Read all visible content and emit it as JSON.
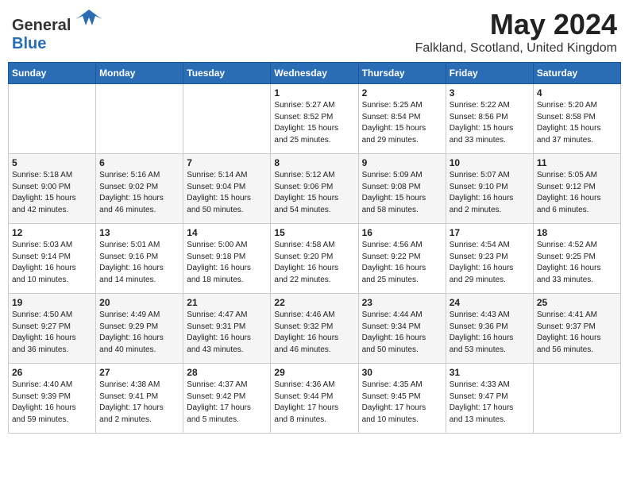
{
  "header": {
    "logo_general": "General",
    "logo_blue": "Blue",
    "month_year": "May 2024",
    "location": "Falkland, Scotland, United Kingdom"
  },
  "days_of_week": [
    "Sunday",
    "Monday",
    "Tuesday",
    "Wednesday",
    "Thursday",
    "Friday",
    "Saturday"
  ],
  "weeks": [
    [
      {
        "day": "",
        "info": ""
      },
      {
        "day": "",
        "info": ""
      },
      {
        "day": "",
        "info": ""
      },
      {
        "day": "1",
        "info": "Sunrise: 5:27 AM\nSunset: 8:52 PM\nDaylight: 15 hours\nand 25 minutes."
      },
      {
        "day": "2",
        "info": "Sunrise: 5:25 AM\nSunset: 8:54 PM\nDaylight: 15 hours\nand 29 minutes."
      },
      {
        "day": "3",
        "info": "Sunrise: 5:22 AM\nSunset: 8:56 PM\nDaylight: 15 hours\nand 33 minutes."
      },
      {
        "day": "4",
        "info": "Sunrise: 5:20 AM\nSunset: 8:58 PM\nDaylight: 15 hours\nand 37 minutes."
      }
    ],
    [
      {
        "day": "5",
        "info": "Sunrise: 5:18 AM\nSunset: 9:00 PM\nDaylight: 15 hours\nand 42 minutes."
      },
      {
        "day": "6",
        "info": "Sunrise: 5:16 AM\nSunset: 9:02 PM\nDaylight: 15 hours\nand 46 minutes."
      },
      {
        "day": "7",
        "info": "Sunrise: 5:14 AM\nSunset: 9:04 PM\nDaylight: 15 hours\nand 50 minutes."
      },
      {
        "day": "8",
        "info": "Sunrise: 5:12 AM\nSunset: 9:06 PM\nDaylight: 15 hours\nand 54 minutes."
      },
      {
        "day": "9",
        "info": "Sunrise: 5:09 AM\nSunset: 9:08 PM\nDaylight: 15 hours\nand 58 minutes."
      },
      {
        "day": "10",
        "info": "Sunrise: 5:07 AM\nSunset: 9:10 PM\nDaylight: 16 hours\nand 2 minutes."
      },
      {
        "day": "11",
        "info": "Sunrise: 5:05 AM\nSunset: 9:12 PM\nDaylight: 16 hours\nand 6 minutes."
      }
    ],
    [
      {
        "day": "12",
        "info": "Sunrise: 5:03 AM\nSunset: 9:14 PM\nDaylight: 16 hours\nand 10 minutes."
      },
      {
        "day": "13",
        "info": "Sunrise: 5:01 AM\nSunset: 9:16 PM\nDaylight: 16 hours\nand 14 minutes."
      },
      {
        "day": "14",
        "info": "Sunrise: 5:00 AM\nSunset: 9:18 PM\nDaylight: 16 hours\nand 18 minutes."
      },
      {
        "day": "15",
        "info": "Sunrise: 4:58 AM\nSunset: 9:20 PM\nDaylight: 16 hours\nand 22 minutes."
      },
      {
        "day": "16",
        "info": "Sunrise: 4:56 AM\nSunset: 9:22 PM\nDaylight: 16 hours\nand 25 minutes."
      },
      {
        "day": "17",
        "info": "Sunrise: 4:54 AM\nSunset: 9:23 PM\nDaylight: 16 hours\nand 29 minutes."
      },
      {
        "day": "18",
        "info": "Sunrise: 4:52 AM\nSunset: 9:25 PM\nDaylight: 16 hours\nand 33 minutes."
      }
    ],
    [
      {
        "day": "19",
        "info": "Sunrise: 4:50 AM\nSunset: 9:27 PM\nDaylight: 16 hours\nand 36 minutes."
      },
      {
        "day": "20",
        "info": "Sunrise: 4:49 AM\nSunset: 9:29 PM\nDaylight: 16 hours\nand 40 minutes."
      },
      {
        "day": "21",
        "info": "Sunrise: 4:47 AM\nSunset: 9:31 PM\nDaylight: 16 hours\nand 43 minutes."
      },
      {
        "day": "22",
        "info": "Sunrise: 4:46 AM\nSunset: 9:32 PM\nDaylight: 16 hours\nand 46 minutes."
      },
      {
        "day": "23",
        "info": "Sunrise: 4:44 AM\nSunset: 9:34 PM\nDaylight: 16 hours\nand 50 minutes."
      },
      {
        "day": "24",
        "info": "Sunrise: 4:43 AM\nSunset: 9:36 PM\nDaylight: 16 hours\nand 53 minutes."
      },
      {
        "day": "25",
        "info": "Sunrise: 4:41 AM\nSunset: 9:37 PM\nDaylight: 16 hours\nand 56 minutes."
      }
    ],
    [
      {
        "day": "26",
        "info": "Sunrise: 4:40 AM\nSunset: 9:39 PM\nDaylight: 16 hours\nand 59 minutes."
      },
      {
        "day": "27",
        "info": "Sunrise: 4:38 AM\nSunset: 9:41 PM\nDaylight: 17 hours\nand 2 minutes."
      },
      {
        "day": "28",
        "info": "Sunrise: 4:37 AM\nSunset: 9:42 PM\nDaylight: 17 hours\nand 5 minutes."
      },
      {
        "day": "29",
        "info": "Sunrise: 4:36 AM\nSunset: 9:44 PM\nDaylight: 17 hours\nand 8 minutes."
      },
      {
        "day": "30",
        "info": "Sunrise: 4:35 AM\nSunset: 9:45 PM\nDaylight: 17 hours\nand 10 minutes."
      },
      {
        "day": "31",
        "info": "Sunrise: 4:33 AM\nSunset: 9:47 PM\nDaylight: 17 hours\nand 13 minutes."
      },
      {
        "day": "",
        "info": ""
      }
    ]
  ]
}
